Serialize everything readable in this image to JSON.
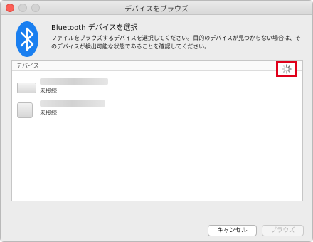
{
  "window": {
    "title": "デバイスをブラウズ"
  },
  "header": {
    "logo_icon": "bluetooth-icon",
    "heading": "Bluetooth デバイスを選択",
    "description": "ファイルをブラウズするデバイスを選択してください。目的のデバイスが見つからない場合は、そのデバイスが検出可能な状態であることを確認してください。"
  },
  "devices": {
    "column_header": "デバイス",
    "loading_icon": "spinner-icon",
    "items": [
      {
        "icon": "keyboard-icon",
        "status": "未接続"
      },
      {
        "icon": "trackpad-icon",
        "status": "未接続"
      }
    ]
  },
  "buttons": {
    "cancel_label": "キャンセル",
    "browse_label": "ブラウズ",
    "browse_enabled": false
  },
  "colors": {
    "bluetooth_blue": "#1a7ff0",
    "close_red": "#fc5f57",
    "highlight_red": "#e0001a"
  }
}
